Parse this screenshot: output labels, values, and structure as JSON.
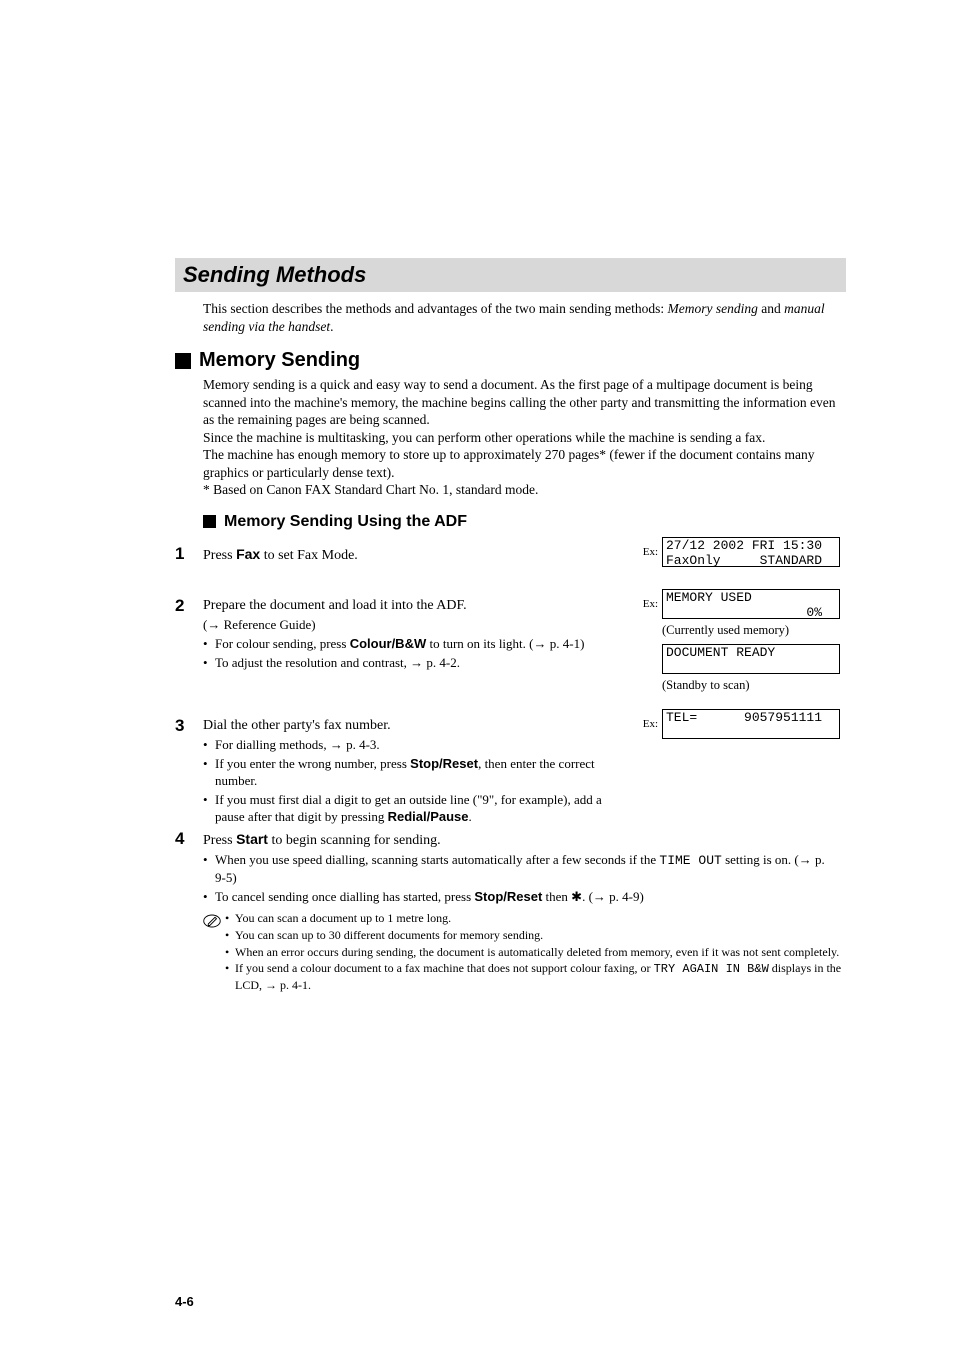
{
  "section_title": "Sending Methods",
  "intro_a": "This section describes the methods and advantages of the two main sending methods: ",
  "intro_em1": "Memory sending",
  "intro_mid": " and ",
  "intro_em2": "manual sending via the handset",
  "intro_end": ".",
  "h2": "Memory Sending",
  "mem_para1": "Memory sending is a quick and easy way to send a document. As the first page of a multipage document is being scanned into the machine's memory, the machine begins calling the other party and transmitting the information even as the remaining pages are being scanned.",
  "mem_para2": "Since the machine is multitasking, you can perform other operations while the machine is sending a fax.",
  "mem_para3": "The machine has enough memory to store up to approximately 270 pages* (fewer if the document contains many graphics or particularly dense text).",
  "mem_footnote": "* Based on Canon FAX Standard Chart No. 1, standard mode.",
  "h3": "Memory Sending Using the ADF",
  "step1": {
    "num": "1",
    "text_a": "Press ",
    "bold1": "Fax",
    "text_b": " to set Fax Mode.",
    "lcd_ex": "Ex:",
    "lcd_line1": "27/12 2002 FRI 15:30",
    "lcd_line2": "FaxOnly     STANDARD"
  },
  "step2": {
    "num": "2",
    "text_a": "Prepare the document and load it into the ADF.",
    "sub1": "(→ Reference Guide)",
    "b1_a": "For colour sending, press ",
    "b1_bold": "Colour/B&W",
    "b1_b": " to turn on its light. (→ p. 4-1)",
    "b2": "To adjust the resolution and contrast, → p. 4-2.",
    "lcd_ex": "Ex:",
    "lcd1_line1": "MEMORY USED",
    "lcd1_line2": "                  0%",
    "caption1": "(Currently used memory)",
    "lcd2_line1": "DOCUMENT READY",
    "lcd2_line2": "",
    "caption2": "(Standby to scan)"
  },
  "step3": {
    "num": "3",
    "text_a": "Dial the other party's fax number.",
    "b1": "For dialling methods, → p. 4-3.",
    "b2_a": "If you enter the wrong number, press ",
    "b2_bold": "Stop/Reset",
    "b2_b": ", then enter the correct number.",
    "b3_a": "If you must first dial a digit to get an outside line (\"9\", for example), add a pause after that digit by pressing ",
    "b3_bold": "Redial/Pause",
    "b3_b": ".",
    "lcd_ex": "Ex:",
    "lcd_line1": "TEL=      9057951111",
    "lcd_line2": ""
  },
  "step4": {
    "num": "4",
    "text_a": "Press ",
    "bold1": "Start",
    "text_b": " to begin scanning for sending.",
    "b1_a": "When you use speed dialling, scanning starts automatically after a few seconds if the ",
    "b1_mono": "TIME OUT",
    "b1_b": " setting is on. (→ p. 9-5)",
    "b2_a": "To cancel sending once dialling has started, press ",
    "b2_bold": "Stop/Reset",
    "b2_b": " then ",
    "b2_star": "✱",
    "b2_c": ". (→ p. 4-9)"
  },
  "notes": {
    "n1": "You can scan a document up to 1 metre long.",
    "n2": "You can scan up to 30 different documents for memory sending.",
    "n3": "When an error occurs during sending, the document is automatically deleted from memory, even if it was not sent completely.",
    "n4_a": "If you send a colour document to a fax machine that does not support colour faxing, or ",
    "n4_mono": "TRY AGAIN IN B&W",
    "n4_b": " displays in the LCD, → p. 4-1."
  },
  "page_number": "4-6"
}
